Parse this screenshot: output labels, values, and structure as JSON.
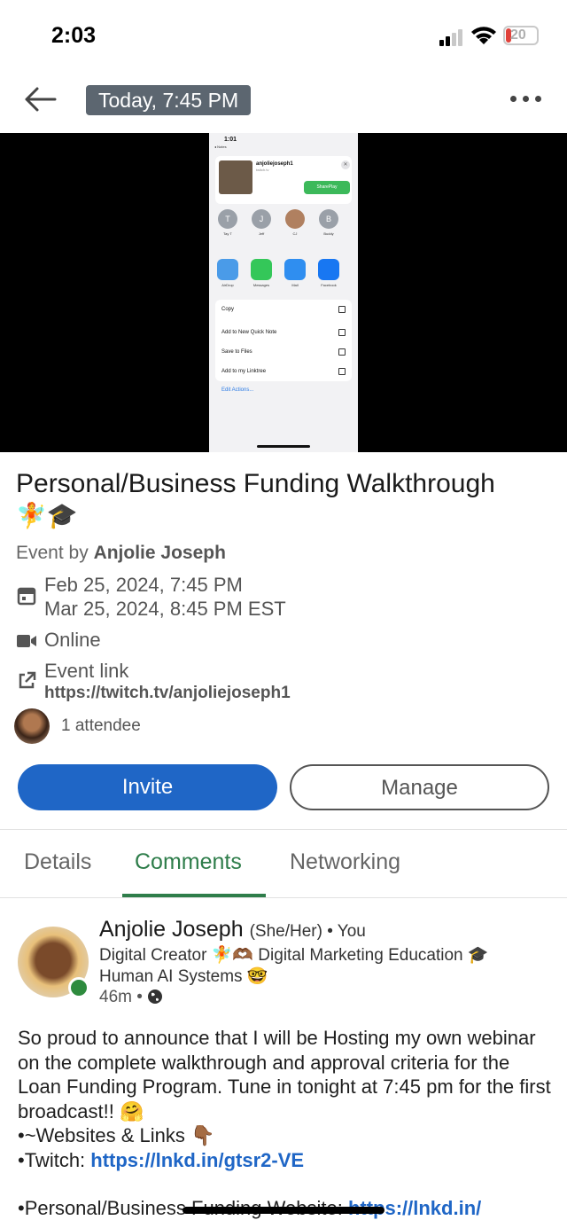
{
  "status_bar": {
    "time": "2:03",
    "battery": "20"
  },
  "header": {
    "date_chip": "Today, 7:45 PM"
  },
  "video_preview": {
    "time": "1:01",
    "back_label": "◂ Notes",
    "card_name": "anjoliejoseph1",
    "card_sub": "twitch.tv",
    "shareplay": "SharePlay",
    "people": [
      {
        "initial": "T",
        "label": "Tay T"
      },
      {
        "initial": "J",
        "label": "Jeff"
      },
      {
        "initial": "",
        "label": "CJ"
      },
      {
        "initial": "B",
        "label": "Buddy"
      }
    ],
    "apps": [
      {
        "label": "AirDrop",
        "color": "#4a9be8"
      },
      {
        "label": "Messages",
        "color": "#34c759"
      },
      {
        "label": "Mail",
        "color": "#2f8ef0"
      },
      {
        "label": "Facebook",
        "color": "#1877f2"
      }
    ],
    "actions": [
      "Copy",
      "Add to New Quick Note",
      "Save to Files",
      "Add to my Linktree"
    ],
    "edit_actions": "Edit Actions..."
  },
  "event": {
    "title": "Personal/Business Funding Walkthrough",
    "title_emoji": "🧚🎓",
    "organizer_prefix": "Event by ",
    "organizer": "Anjolie Joseph",
    "date_start": "Feb 25, 2024, 7:45 PM",
    "date_end": "Mar 25, 2024, 8:45 PM EST",
    "location": "Online",
    "link_label": "Event link",
    "link_url": "https://twitch.tv/anjoliejoseph1",
    "attendees": "1 attendee"
  },
  "actions": {
    "invite": "Invite",
    "manage": "Manage"
  },
  "tabs": [
    {
      "label": "Details"
    },
    {
      "label": "Comments"
    },
    {
      "label": "Networking"
    }
  ],
  "comment": {
    "author": "Anjolie Joseph",
    "pronouns": "(She/Her)",
    "you": " • You",
    "headline_1": "Digital Creator 🧚🫶🏾 Digital Marketing Education 🎓",
    "headline_2": "Human AI Systems 🤓",
    "time": "46m •",
    "body_1": "So proud to announce that I will be Hosting my own webinar on the complete walkthrough and approval criteria for the Loan Funding Program. Tune in tonight at 7:45 pm for the first broadcast!! 🤗",
    "body_2": "•~Websites & Links 👇🏾",
    "body_3_prefix": "•Twitch: ",
    "body_3_link": "https://lnkd.in/gtsr2-VE",
    "body_4_prefix": "•Personal/Business Funding Website: ",
    "body_4_link": "https://lnkd.in/"
  }
}
